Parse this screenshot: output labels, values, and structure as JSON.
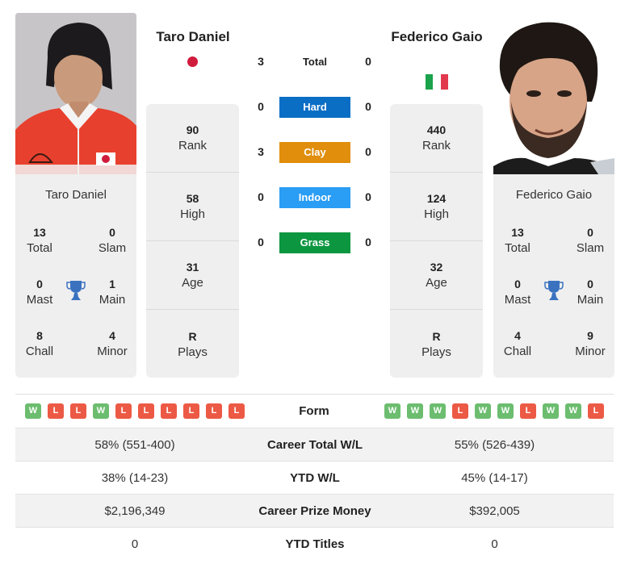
{
  "players": {
    "left": {
      "name": "Taro Daniel",
      "country_flag": "japan-flag",
      "stats": [
        {
          "value": "90",
          "label": "Rank"
        },
        {
          "value": "58",
          "label": "High"
        },
        {
          "value": "31",
          "label": "Age"
        },
        {
          "value": "R",
          "label": "Plays"
        }
      ],
      "titles": {
        "total": {
          "value": "13",
          "label": "Total"
        },
        "slam": {
          "value": "0",
          "label": "Slam"
        },
        "mast": {
          "value": "0",
          "label": "Mast"
        },
        "main": {
          "value": "1",
          "label": "Main"
        },
        "chall": {
          "value": "8",
          "label": "Chall"
        },
        "minor": {
          "value": "4",
          "label": "Minor"
        }
      },
      "form": [
        "W",
        "L",
        "L",
        "W",
        "L",
        "L",
        "L",
        "L",
        "L",
        "L"
      ]
    },
    "right": {
      "name": "Federico Gaio",
      "country_flag": "italy-flag",
      "stats": [
        {
          "value": "440",
          "label": "Rank"
        },
        {
          "value": "124",
          "label": "High"
        },
        {
          "value": "32",
          "label": "Age"
        },
        {
          "value": "R",
          "label": "Plays"
        }
      ],
      "titles": {
        "total": {
          "value": "13",
          "label": "Total"
        },
        "slam": {
          "value": "0",
          "label": "Slam"
        },
        "mast": {
          "value": "0",
          "label": "Mast"
        },
        "main": {
          "value": "0",
          "label": "Main"
        },
        "chall": {
          "value": "4",
          "label": "Chall"
        },
        "minor": {
          "value": "9",
          "label": "Minor"
        }
      },
      "form": [
        "W",
        "W",
        "W",
        "L",
        "W",
        "W",
        "L",
        "W",
        "W",
        "L"
      ]
    }
  },
  "h2h": [
    {
      "label": "Total",
      "left": "3",
      "right": "0",
      "color": ""
    },
    {
      "label": "Hard",
      "left": "0",
      "right": "0",
      "color": "#0a6ec5"
    },
    {
      "label": "Clay",
      "left": "3",
      "right": "0",
      "color": "#e08e0b"
    },
    {
      "label": "Indoor",
      "left": "0",
      "right": "0",
      "color": "#2a9df4"
    },
    {
      "label": "Grass",
      "left": "0",
      "right": "0",
      "color": "#0c9640"
    }
  ],
  "form_label": "Form",
  "comparison": [
    {
      "label": "Career Total W/L",
      "left": "58% (551-400)",
      "right": "55% (526-439)"
    },
    {
      "label": "YTD W/L",
      "left": "38% (14-23)",
      "right": "45% (14-17)"
    },
    {
      "label": "Career Prize Money",
      "left": "$2,196,349",
      "right": "$392,005"
    },
    {
      "label": "YTD Titles",
      "left": "0",
      "right": "0"
    }
  ],
  "colors": {
    "win": "#6cbd6f",
    "loss": "#ec5a45",
    "trophy": "#3a72c0",
    "japan_red": "#d01c3c",
    "italy_green": "#1aa34a",
    "italy_white": "#ffffff",
    "italy_red": "#e2384d"
  }
}
